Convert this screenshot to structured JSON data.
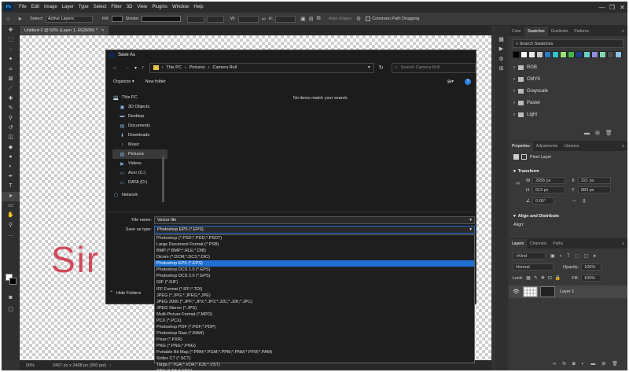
{
  "menubar": {
    "app_icon": "Ps",
    "items": [
      "File",
      "Edit",
      "Image",
      "Layer",
      "Type",
      "Select",
      "Filter",
      "3D",
      "View",
      "Plugins",
      "Window",
      "Help"
    ],
    "window_controls": [
      "—",
      "❐",
      "✕"
    ]
  },
  "options": {
    "select_label": "Select:",
    "select_value": "Active Layers",
    "fill_label": "Fill:",
    "stroke_label": "Stroke:",
    "align_edges": "Align Edges",
    "constrain_path": "Constrain Path Dragging"
  },
  "document": {
    "tab_title": "Untitled-2 @ 50% (Layer 1, RGB/8#) *",
    "art_text": "Sir",
    "zoom": "50%",
    "doc_size": "2467 px x 2408 px (300 ppi)"
  },
  "swatches_panel": {
    "tabs": [
      "Color",
      "Swatches",
      "Gradients",
      "Patterns"
    ],
    "active_tab": "Swatches",
    "search_placeholder": "Search Swatches",
    "colors": [
      "#000000",
      "#ffffff",
      "#e8e8e8",
      "#c9c9c9",
      "#2d7bc4",
      "#33c4cf",
      "#9be07a",
      "#45b84e",
      "#1f3f8c",
      "#6fd0c8",
      "#8f8fe0",
      "#7fd9b0",
      "#4a4a4a",
      "#8ec4e8"
    ],
    "folders": [
      "RGB",
      "CMYK",
      "Grayscale",
      "Pastel",
      "Light"
    ]
  },
  "properties_panel": {
    "tabs": [
      "Properties",
      "Adjustments",
      "Libraries"
    ],
    "active_tab": "Properties",
    "layer_type": "Pixel Layer",
    "transform_title": "Transform",
    "w_label": "W",
    "w_value": "2055 px",
    "x_label": "X",
    "x_value": "221 px",
    "h_label": "H",
    "h_value": "613 px",
    "y_label": "Y",
    "y_value": "883 px",
    "angle": "0.00°",
    "align_title": "Align and Distribute",
    "align_label": "Align:"
  },
  "layers_panel": {
    "tabs": [
      "Layers",
      "Channels",
      "Paths"
    ],
    "active_tab": "Layers",
    "filter_kind": "Kind",
    "blend_mode": "Normal",
    "opacity_label": "Opacity:",
    "opacity_value": "100%",
    "lock_label": "Lock:",
    "fill_label": "Fill:",
    "fill_value": "100%",
    "layer_name": "Layer 1"
  },
  "dialog": {
    "title": "Save As",
    "breadcrumb": [
      "This PC",
      "Pictures",
      "Camera Roll"
    ],
    "search_placeholder": "Search Camera Roll",
    "organize": "Organize",
    "new_folder": "New folder",
    "empty_message": "No items match your search.",
    "nav_items": [
      {
        "label": "This PC",
        "icon": "💻"
      },
      {
        "label": "3D Objects",
        "icon": "▣"
      },
      {
        "label": "Desktop",
        "icon": "▬"
      },
      {
        "label": "Documents",
        "icon": "▤"
      },
      {
        "label": "Downloads",
        "icon": "⬇"
      },
      {
        "label": "Music",
        "icon": "♪"
      },
      {
        "label": "Pictures",
        "icon": "▧"
      },
      {
        "label": "Videos",
        "icon": "▶"
      },
      {
        "label": "Acer (C:)",
        "icon": "▭"
      },
      {
        "label": "DATA (D:)",
        "icon": "▭"
      },
      {
        "label": "Network",
        "icon": "⬡"
      }
    ],
    "selected_nav": 6,
    "file_name_label": "File name:",
    "file_name_value": "Vector file",
    "save_type_label": "Save as type:",
    "save_type_value": "Photoshop EPS (*.EPS)",
    "hide_folders": "Hide Folders",
    "type_options": [
      "Photoshop (*.PSD;*.PDD;*.PSDT)",
      "Large Document Format (*.PSB)",
      "BMP (*.BMP;*.RLE;*.DIB)",
      "Dicom (*.DCM;*.DC3;*.DIC)",
      "Photoshop EPS (*.EPS)",
      "Photoshop DCS 1.0 (*.EPS)",
      "Photoshop DCS 2.0 (*.EPS)",
      "GIF (*.GIF)",
      "IFF Format (*.IFF;*.TDI)",
      "JPEG (*.JPG;*.JPEG;*.JPE)",
      "JPEG 2000 (*.JPF;*.JPX;*.JP2;*.J2C;*.J2K;*.JPC)",
      "JPEG Stereo (*.JPS)",
      "Multi-Picture Format (*.MPO)",
      "PCX (*.PCX)",
      "Photoshop PDF (*.PDF;*.PDP)",
      "Photoshop Raw (*.RAW)",
      "Pixar (*.PXR)",
      "PNG (*.PNG;*.PNG)",
      "Portable Bit Map (*.PBM;*.PGM;*.PPM;*.PNM;*.PFM;*.PAM)",
      "Scitex CT (*.SCT)",
      "Targa (*.TGA;*.VDA;*.ICB;*.VST)",
      "TIFF (*.TIF;*.TIFF)"
    ],
    "selected_type": 4
  }
}
